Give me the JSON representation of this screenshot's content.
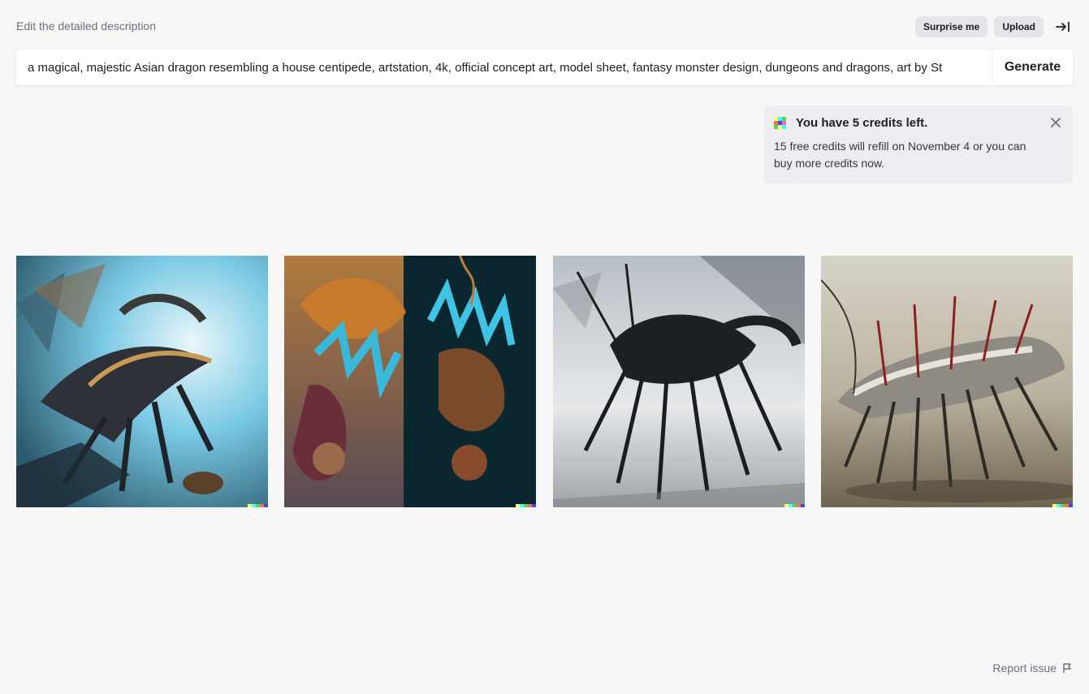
{
  "header": {
    "hint": "Edit the detailed description",
    "surprise_label": "Surprise me",
    "upload_label": "Upload"
  },
  "prompt": {
    "value": "a magical, majestic Asian dragon resembling a house centipede, artstation, 4k, official concept art, model sheet, fantasy monster design, dungeons and dragons, art by St",
    "generate_label": "Generate"
  },
  "credits": {
    "title": "You have 5 credits left.",
    "body": "15 free credits will refill on November 4 or you can buy more credits now."
  },
  "images": [
    {
      "name": "generated-image-1",
      "palette": [
        "#6fc3e0",
        "#2b3a46",
        "#a87a3e"
      ]
    },
    {
      "name": "generated-image-2",
      "palette": [
        "#8a5a2e",
        "#0b2a33",
        "#3ab0d0"
      ]
    },
    {
      "name": "generated-image-3",
      "palette": [
        "#d9dde0",
        "#1b1d20",
        "#7d8288"
      ]
    },
    {
      "name": "generated-image-4",
      "palette": [
        "#c9c4b4",
        "#3a3530",
        "#9a8f7c"
      ]
    }
  ],
  "signature_colors": [
    "#ffff66",
    "#42ffff",
    "#51da4c",
    "#ff6e3c",
    "#3c46ff"
  ],
  "footer": {
    "report_label": "Report issue"
  }
}
